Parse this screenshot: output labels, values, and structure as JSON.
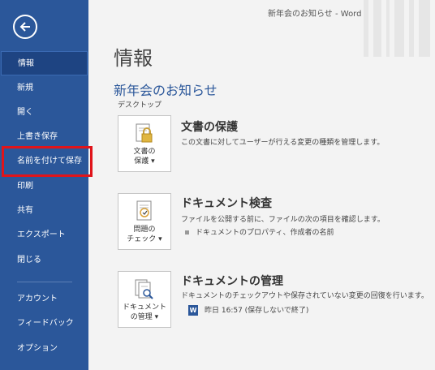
{
  "window": {
    "title": "新年会のお知らせ  -  Word"
  },
  "sidebar": {
    "items": [
      {
        "label": "情報"
      },
      {
        "label": "新規"
      },
      {
        "label": "開く"
      },
      {
        "label": "上書き保存"
      },
      {
        "label": "名前を付けて保存"
      },
      {
        "label": "印刷"
      },
      {
        "label": "共有"
      },
      {
        "label": "エクスポート"
      },
      {
        "label": "閉じる"
      },
      {
        "label": "アカウント"
      },
      {
        "label": "フィードバック"
      },
      {
        "label": "オプション"
      }
    ]
  },
  "main": {
    "title": "情報",
    "doc_name": "新年会のお知らせ",
    "doc_location": "デスクトップ",
    "protect": {
      "tile_line1": "文書の",
      "tile_line2": "保護 ▾",
      "title": "文書の保護",
      "desc": "この文書に対してユーザーが行える変更の種類を管理します。"
    },
    "inspect": {
      "tile_line1": "問題の",
      "tile_line2": "チェック ▾",
      "title": "ドキュメント検査",
      "desc": "ファイルを公開する前に、ファイルの次の項目を確認します。",
      "bullet": "ドキュメントのプロパティ、作成者の名前"
    },
    "manage": {
      "tile_line1": "ドキュメント",
      "tile_line2": "の管理 ▾",
      "title": "ドキュメントの管理",
      "desc": "ドキュメントのチェックアウトや保存されていない変更の回復を行います。",
      "version": "昨日 16:57 (保存しないで終了)"
    }
  }
}
